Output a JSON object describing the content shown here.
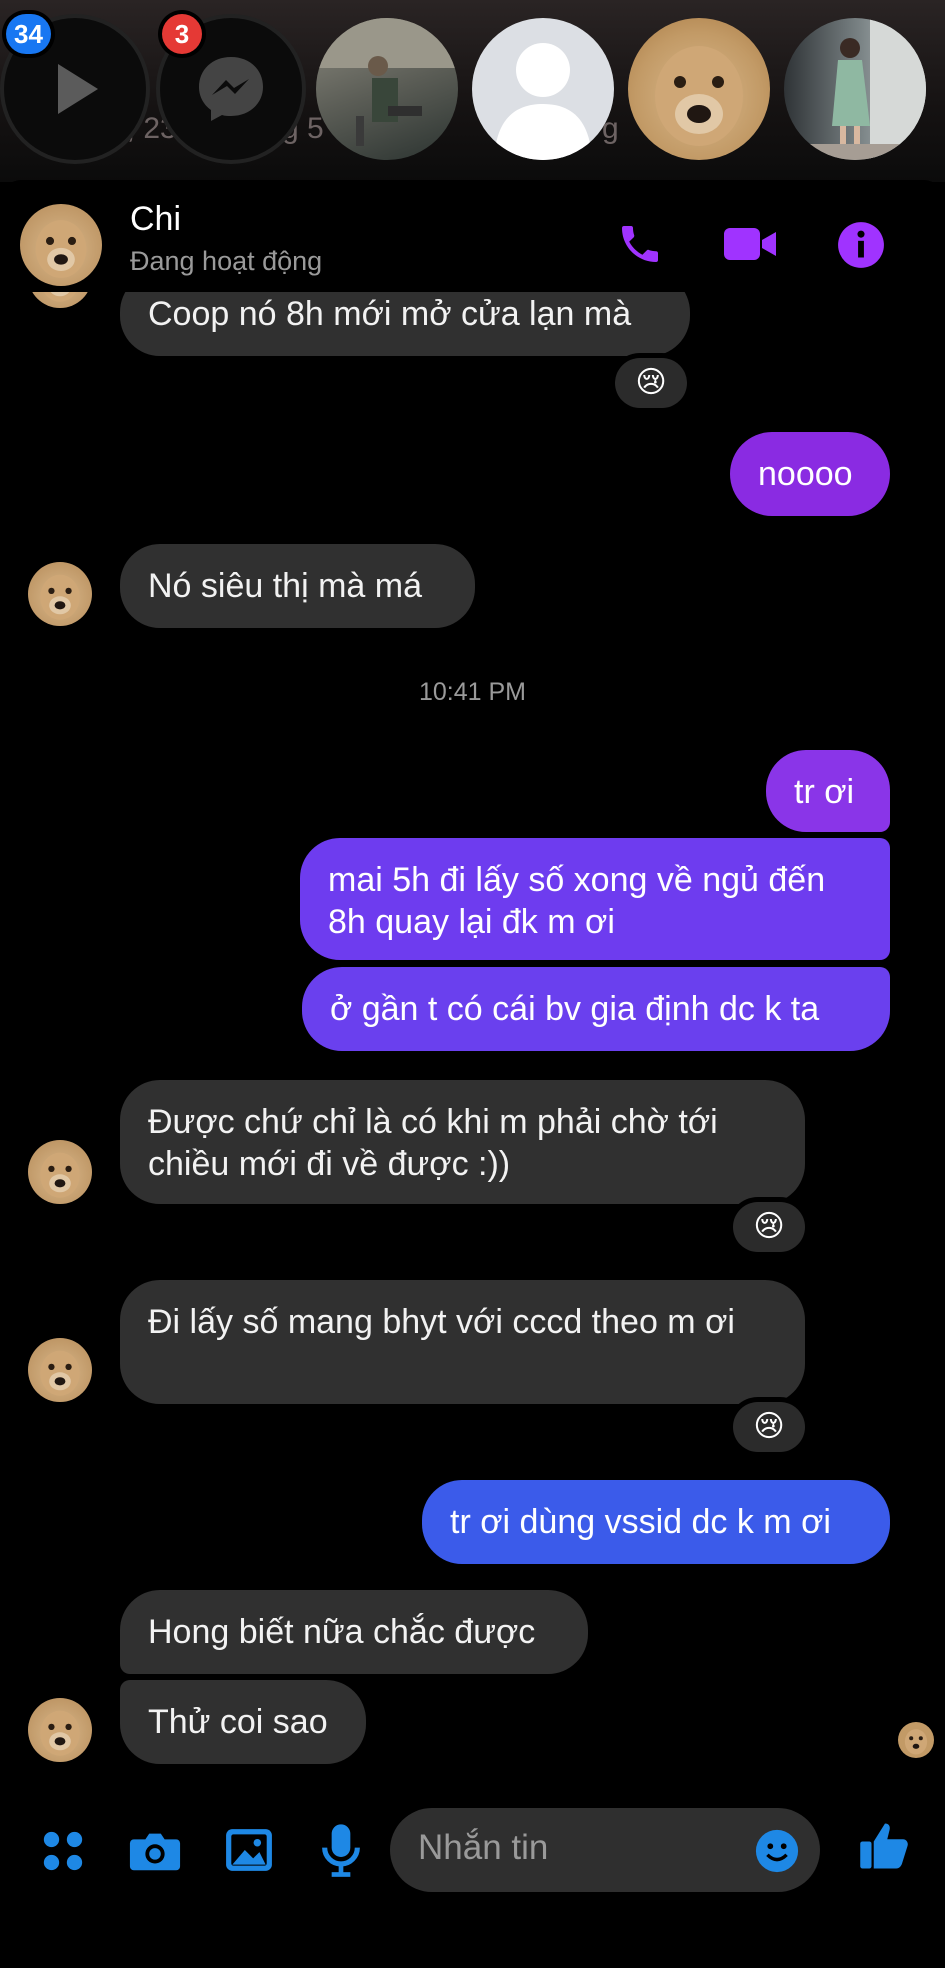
{
  "stories": {
    "reel_badge": "34",
    "messenger_badge": "3",
    "bg_text_left": "9, 23",
    "bg_text_mid": "g 5",
    "bg_text_right": "g"
  },
  "header": {
    "name": "Chi",
    "status": "Đang hoạt động"
  },
  "messages": {
    "m1": "Coop nó 8h mới mở cửa lạn mà",
    "m2": "noooo",
    "m3": "Nó siêu thị mà má",
    "time": "10:41 PM",
    "m4": "tr ơi",
    "m5": "mai 5h đi lấy số xong về ngủ đến 8h quay lại đk m ơi",
    "m6": "ở gần t có cái bv gia định dc k ta",
    "m7": "Được chứ chỉ là có khi m phải chờ tới chiều mới đi về được :))",
    "m8": "Đi lấy số mang bhyt với cccd theo m ơi",
    "m9": "tr ơi dùng vssid dc k m ơi",
    "m10": "Hong biết nữa chắc được",
    "m11": "Thử coi sao",
    "reaction": "😢"
  },
  "composer": {
    "placeholder": "Nhắn tin"
  },
  "colors": {
    "accent": "#a033ff",
    "blue": "#1e88e5",
    "incoming": "#303030",
    "out_purple_top": "#8a2be2",
    "out_purple_mid": "#6a3cf0",
    "out_blue": "#3b5bea"
  }
}
